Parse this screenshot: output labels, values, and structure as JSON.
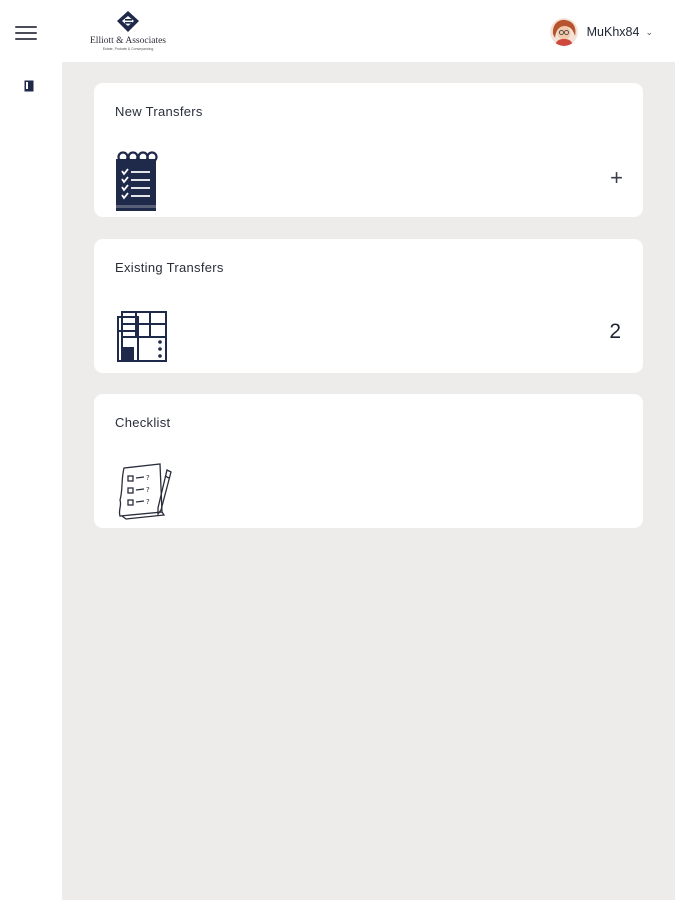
{
  "brand": {
    "name": "Elliott & Associates",
    "tagline": "Estate, Probate & Conveyancing"
  },
  "user": {
    "username": "MuKhx84",
    "dropdown_icon": "chevron-down-icon"
  },
  "sidebar": {
    "menu_icon": "hamburger-menu-icon",
    "items": [
      {
        "icon": "document-icon"
      }
    ]
  },
  "cards": {
    "new_transfers": {
      "title": "New Transfers",
      "icon": "notepad-checklist-icon",
      "action": "+"
    },
    "existing_transfers": {
      "title": "Existing Transfers",
      "icon": "building-icon",
      "count": "2"
    },
    "checklist": {
      "title": "Checklist",
      "icon": "checklist-sketch-icon"
    }
  },
  "colors": {
    "navy": "#1f2a4a",
    "background": "#edeceb",
    "card": "#ffffff"
  }
}
